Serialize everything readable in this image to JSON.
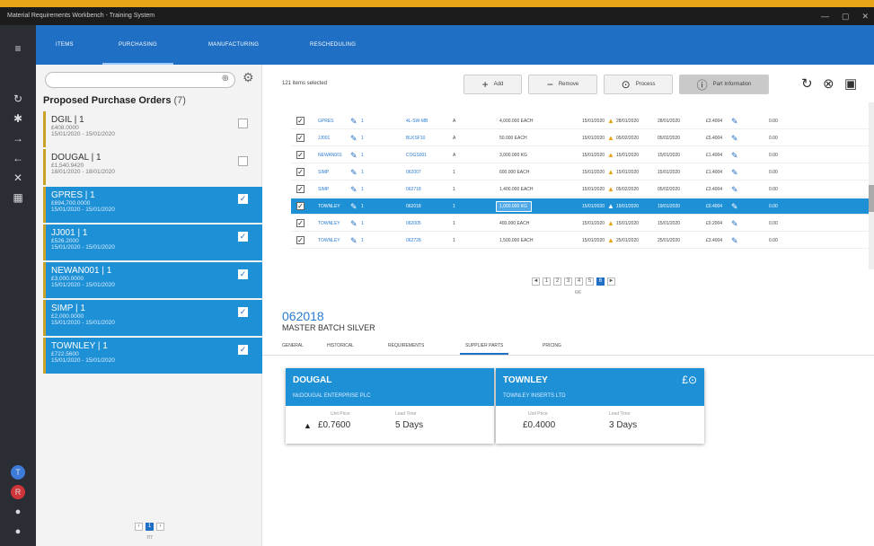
{
  "window": {
    "title": "Material Requirements Workbench - Training System",
    "controls": [
      "—",
      "▢",
      "✕"
    ]
  },
  "top_tabs": [
    "ITEMS",
    "PURCHASING",
    "MANUFACTURING",
    "RESCHEDULING"
  ],
  "left_panel": {
    "title": "Proposed Purchase Orders",
    "count": "(7)",
    "orders": [
      {
        "name": "DGIL | 1",
        "amount": "£408.0000",
        "dates": "15/01/2020 - 15/01/2020",
        "checked": false
      },
      {
        "name": "DOUGAL | 1",
        "amount": "£1,540.9420",
        "dates": "18/01/2020 - 18/01/2020",
        "checked": false
      },
      {
        "name": "GPRES | 1",
        "amount": "£694,700.0000",
        "dates": "15/01/2020 - 15/01/2020",
        "checked": true
      },
      {
        "name": "JJ001 | 1",
        "amount": "£526.2000",
        "dates": "15/01/2020 - 15/01/2020",
        "checked": true
      },
      {
        "name": "NEWAN001 | 1",
        "amount": "£3,000.0000",
        "dates": "15/01/2020 - 15/01/2020",
        "checked": true
      },
      {
        "name": "SIMP | 1",
        "amount": "£2,000.0000",
        "dates": "15/01/2020 - 15/01/2020",
        "checked": true
      },
      {
        "name": "TOWNLEY | 1",
        "amount": "£722.5600",
        "dates": "15/01/2020 - 15/01/2020",
        "checked": true
      }
    ],
    "pager": {
      "prev": "‹",
      "page": "1",
      "next": "›",
      "count": "7/7"
    }
  },
  "toolbar": {
    "selected_text": "121 items selected",
    "add_label": "Add",
    "remove_label": "Remove",
    "process_label": "Process",
    "info_label": "Part Information"
  },
  "grid": {
    "rows": [
      {
        "checked": true,
        "supplier": "GPRES",
        "qty_link": "1",
        "part": "4L-SW-MB",
        "ln": "A",
        "qty": "4,000.000 EACH",
        "due": "15/01/2020",
        "d1": "28/01/2020",
        "d2": "28/01/2020",
        "price": "£3.4004",
        "ccy": "0.00",
        "warn": true,
        "hl": false
      },
      {
        "checked": true,
        "supplier": "JJ001",
        "qty_link": "1",
        "part": "BLKSF10",
        "ln": "A",
        "qty": "50.000 EACH",
        "due": "15/01/2020",
        "d1": "05/02/2020",
        "d2": "05/02/2020",
        "price": "£5.4004",
        "ccy": "0.00",
        "warn": true,
        "hl": false
      },
      {
        "checked": true,
        "supplier": "NEWAN001",
        "qty_link": "1",
        "part": "COGS001",
        "ln": "A",
        "qty": "3,000.000 KG",
        "due": "15/01/2020",
        "d1": "15/01/2020",
        "d2": "15/01/2020",
        "price": "£1.4004",
        "ccy": "0.00",
        "warn": true,
        "hl": false
      },
      {
        "checked": true,
        "supplier": "SIMP",
        "qty_link": "1",
        "part": "062007",
        "ln": "1",
        "qty": "600.000 EACH",
        "due": "15/01/2020",
        "d1": "15/01/2020",
        "d2": "15/01/2020",
        "price": "£1.4004",
        "ccy": "0.00",
        "warn": true,
        "hl": false
      },
      {
        "checked": true,
        "supplier": "SIMP",
        "qty_link": "1",
        "part": "062718",
        "ln": "1",
        "qty": "1,400.000 EACH",
        "due": "15/01/2020",
        "d1": "05/02/2020",
        "d2": "05/02/2020",
        "price": "£3.4004",
        "ccy": "0.00",
        "warn": true,
        "hl": false
      },
      {
        "checked": true,
        "supplier": "TOWNLEY",
        "qty_link": "1",
        "part": "062018",
        "ln": "1",
        "qty": "1,000.000 KG",
        "due": "15/01/2020",
        "d1": "19/01/2020",
        "d2": "19/01/2020",
        "price": "£0.4004",
        "ccy": "0.00",
        "warn": true,
        "hl": true
      },
      {
        "checked": true,
        "supplier": "TOWNLEY",
        "qty_link": "1",
        "part": "062005",
        "ln": "1",
        "qty": "400.000 EACH",
        "due": "15/01/2020",
        "d1": "15/01/2020",
        "d2": "15/01/2020",
        "price": "£0.2004",
        "ccy": "0.00",
        "warn": true,
        "hl": false
      },
      {
        "checked": true,
        "supplier": "TOWNLEY",
        "qty_link": "1",
        "part": "062728",
        "ln": "1",
        "qty": "1,500.000 EACH",
        "due": "15/01/2020",
        "d1": "25/01/2020",
        "d2": "25/01/2020",
        "price": "£3.4004",
        "ccy": "0.00",
        "warn": true,
        "hl": false
      }
    ],
    "pager": {
      "pages": [
        "◄",
        "1",
        "2",
        "3",
        "4",
        "5",
        "6",
        "►"
      ],
      "current": "6",
      "count": "6/6"
    }
  },
  "detail": {
    "code": "062018",
    "description": "MASTER BATCH SILVER",
    "tabs": [
      "GENERAL",
      "HISTORICAL",
      "REQUIREMENTS",
      "SUPPLIER PARTS",
      "PRICING"
    ],
    "active_tab": "SUPPLIER PARTS",
    "cards": [
      {
        "supplier": "DOUGAL",
        "full_name": "McDOUGAL ENTERPRISE PLC",
        "unit_price_label": "Unit Price",
        "unit_price": "£0.7600",
        "lead_label": "Lead Time",
        "lead": "5 Days",
        "warning": true
      },
      {
        "supplier": "TOWNLEY",
        "full_name": "TOWNLEY INSERTS LTD",
        "unit_price_label": "Unit Price",
        "unit_price": "£0.4000",
        "lead_label": "Lead Time",
        "lead": "3 Days",
        "warning": false,
        "currency_icon": "£⊙"
      }
    ]
  },
  "colors": {
    "accent": "#1f6fc4",
    "selected": "#1e90d6",
    "frame": "#e8a516",
    "rail": "#2a2d33",
    "warning": "#e8a516"
  }
}
